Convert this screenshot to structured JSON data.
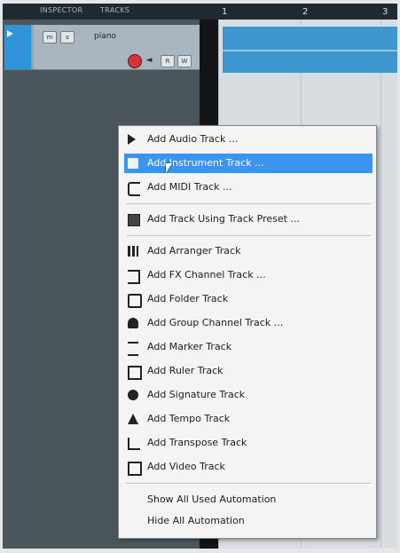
{
  "header": {
    "labels": [
      "INSPECTOR",
      "TRACKS"
    ],
    "ruler": [
      "1",
      "2",
      "3"
    ]
  },
  "track": {
    "buttons": [
      "m",
      "s"
    ],
    "name": "piano",
    "read_label": "R",
    "write_label": "W",
    "monitor_label": "◄"
  },
  "menu": {
    "items": [
      {
        "label": "Add Audio Track ...",
        "icon": "play-icon"
      },
      {
        "label": "Add Instrument Track ...",
        "icon": "instrument-icon",
        "highlighted": true
      },
      {
        "label": "Add MIDI Track ...",
        "icon": "midi-icon"
      },
      {
        "label": "Add Track Using Track Preset ...",
        "icon": "track-preset-icon"
      },
      {
        "label": "Add Arranger Track",
        "icon": "arranger-icon"
      },
      {
        "label": "Add FX Channel Track ...",
        "icon": "fx-channel-icon"
      },
      {
        "label": "Add Folder Track",
        "icon": "folder-icon"
      },
      {
        "label": "Add Group Channel Track ...",
        "icon": "group-channel-icon"
      },
      {
        "label": "Add Marker Track",
        "icon": "marker-icon"
      },
      {
        "label": "Add Ruler Track",
        "icon": "ruler-icon"
      },
      {
        "label": "Add Signature Track",
        "icon": "signature-icon"
      },
      {
        "label": "Add Tempo Track",
        "icon": "tempo-icon"
      },
      {
        "label": "Add Transpose Track",
        "icon": "transpose-icon"
      },
      {
        "label": "Add Video Track",
        "icon": "video-icon"
      },
      {
        "label": "Show All Used Automation",
        "icon": ""
      },
      {
        "label": "Hide All Automation",
        "icon": ""
      }
    ]
  },
  "colors": {
    "accent": "#2f95d8",
    "menu_highlight": "#3d94ee",
    "record": "#d8323a",
    "clip": "#3d97cf"
  }
}
